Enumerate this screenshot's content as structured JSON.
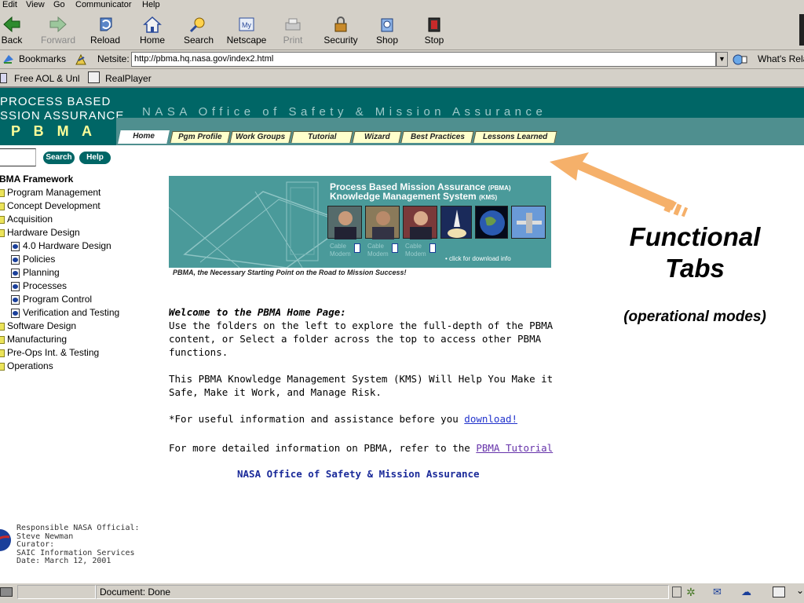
{
  "menu": [
    "Edit",
    "View",
    "Go",
    "Communicator",
    "Help"
  ],
  "toolbar": {
    "buttons": [
      {
        "label": "Back",
        "icon": "back-arrow-icon"
      },
      {
        "label": "Forward",
        "icon": "forward-arrow-icon"
      },
      {
        "label": "Reload",
        "icon": "reload-icon"
      },
      {
        "label": "Home",
        "icon": "home-icon"
      },
      {
        "label": "Search",
        "icon": "search-icon"
      },
      {
        "label": "Netscape",
        "icon": "netscape-icon"
      },
      {
        "label": "Print",
        "icon": "printer-icon"
      },
      {
        "label": "Security",
        "icon": "lock-icon"
      },
      {
        "label": "Shop",
        "icon": "shop-icon"
      },
      {
        "label": "Stop",
        "icon": "stop-icon"
      }
    ]
  },
  "location": {
    "bookmarks_label": "Bookmarks",
    "netsite_label": "Netsite:",
    "url": "http://pbma.hq.nasa.gov/index2.html",
    "whats_related": "What's Rela"
  },
  "personal": {
    "items": [
      "Free AOL & Unl",
      "RealPlayer"
    ]
  },
  "site": {
    "logo_line1": "PROCESS BASED",
    "logo_line2": "SSION ASSURANCE",
    "logo_line3": "P B M A",
    "header_title": "NASA Office of Safety & Mission Assurance",
    "tabs": [
      "Home",
      "Pgm Profile",
      "Work Groups",
      "Tutorial",
      "Wizard",
      "Best Practices",
      "Lessons Learned"
    ],
    "search_button": "Search",
    "help_button": "Help"
  },
  "tree": {
    "root": "BMA Framework",
    "items": [
      {
        "label": "Program Management",
        "type": "folder",
        "level": 0
      },
      {
        "label": "Concept Development",
        "type": "folder",
        "level": 0
      },
      {
        "label": "Acquisition",
        "type": "folder",
        "level": 0
      },
      {
        "label": "Hardware Design",
        "type": "folder-open",
        "level": 0
      },
      {
        "label": "4.0 Hardware Design",
        "type": "doc",
        "level": 1
      },
      {
        "label": "Policies",
        "type": "doc",
        "level": 1
      },
      {
        "label": "Planning",
        "type": "doc",
        "level": 1
      },
      {
        "label": "Processes",
        "type": "doc",
        "level": 1
      },
      {
        "label": "Program Control",
        "type": "doc",
        "level": 1
      },
      {
        "label": "Verification and Testing",
        "type": "doc",
        "level": 1
      },
      {
        "label": "Software Design",
        "type": "folder",
        "level": 0
      },
      {
        "label": "Manufacturing",
        "type": "folder",
        "level": 0
      },
      {
        "label": "Pre-Ops Int. & Testing",
        "type": "folder",
        "level": 0
      },
      {
        "label": "Operations",
        "type": "folder",
        "level": 0
      }
    ]
  },
  "banner": {
    "title1": "Process Based Mission Assurance",
    "title1_suffix": "(PBMA)",
    "title2": "Knowledge Management System",
    "title2_suffix": "(KMS)",
    "cable_modem": [
      "Cable Modem",
      "Cable Modem",
      "Cable Modem"
    ],
    "click_info": "• click for download info",
    "caption": "PBMA, the Necessary Starting Point on the Road to Mission Success!"
  },
  "main": {
    "welcome_title": "Welcome to the PBMA Home Page:",
    "para1": "Use the folders on the left to explore the full-depth of the PBMA content, or Select a folder across the top to access other PBMA functions.",
    "para2": "This PBMA Knowledge Management System (KMS) Will Help You Make it Safe, Make it Work, and Manage Risk.",
    "para3_prefix": "*For useful information and assistance before you ",
    "para3_link": "download!",
    "para4_prefix": "For more detailed information on PBMA, refer to the ",
    "para4_link": "PBMA Tutorial",
    "footer_org": "NASA Office of Safety & Mission Assurance"
  },
  "official": {
    "line1": "Responsible NASA Official:",
    "line2": "Steve Newman",
    "line3": "Curator:",
    "line4": "SAIC Information Services",
    "line5": "Date: March 12, 2001"
  },
  "annotation": {
    "title_line1": "Functional",
    "title_line2": "Tabs",
    "subtitle": "(operational modes)",
    "arrow_color": "#f5b06a"
  },
  "status": {
    "text": "Document: Done"
  },
  "colors": {
    "teal": "#006666",
    "tab_bg": "#ffffcc",
    "chrome": "#d4d0c8",
    "link": "#2233cc",
    "org_text": "#1a2a99"
  }
}
